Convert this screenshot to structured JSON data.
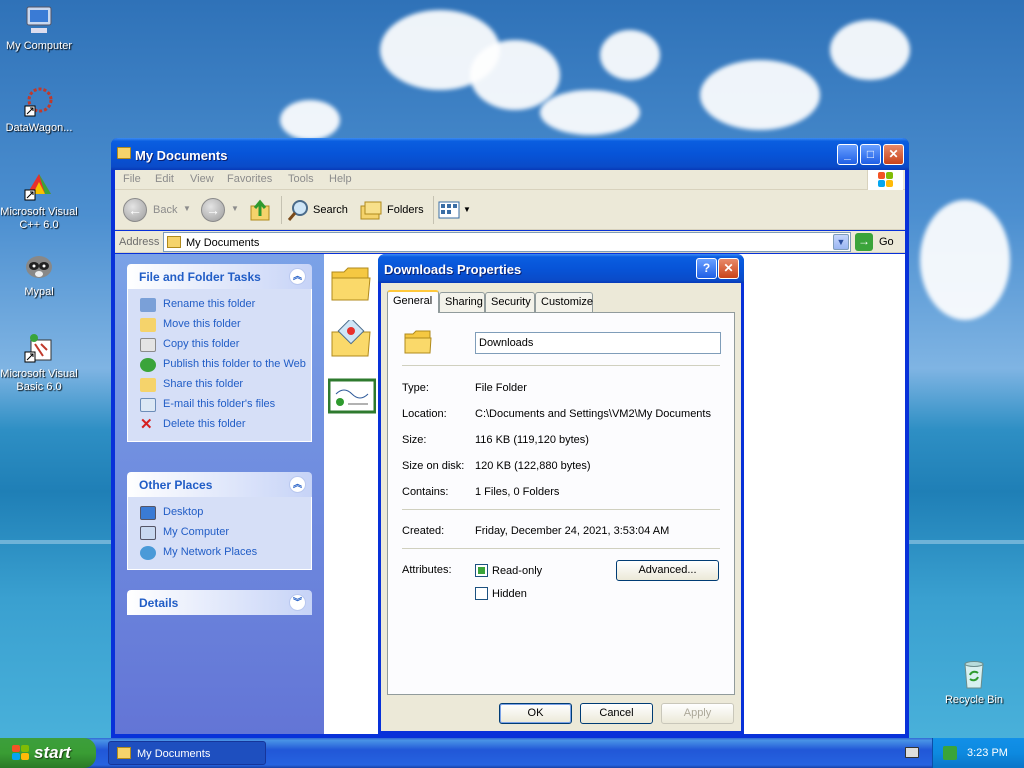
{
  "desktop": {
    "icons": [
      {
        "label": "My Computer"
      },
      {
        "label": "DataWagon..."
      },
      {
        "label": "Microsoft Visual C++ 6.0"
      },
      {
        "label": "Mypal"
      },
      {
        "label": "Microsoft Visual Basic 6.0"
      },
      {
        "label": "Recycle Bin"
      }
    ]
  },
  "explorer": {
    "title": "My Documents",
    "menu": [
      "File",
      "Edit",
      "View",
      "Favorites",
      "Tools",
      "Help"
    ],
    "toolbar": {
      "back": "Back",
      "search": "Search",
      "folders": "Folders"
    },
    "address": {
      "label": "Address",
      "value": "My Documents",
      "go": "Go"
    },
    "tasks_panel": {
      "title": "File and Folder Tasks",
      "items": [
        "Rename this folder",
        "Move this folder",
        "Copy this folder",
        "Publish this folder to the Web",
        "Share this folder",
        "E-mail this folder's files",
        "Delete this folder"
      ]
    },
    "places_panel": {
      "title": "Other Places",
      "items": [
        "Desktop",
        "My Computer",
        "My Network Places"
      ]
    },
    "details_panel": {
      "title": "Details"
    }
  },
  "dialog": {
    "title": "Downloads Properties",
    "tabs": [
      "General",
      "Sharing",
      "Security",
      "Customize"
    ],
    "active_tab": "General",
    "name_value": "Downloads",
    "fields": {
      "type": {
        "label": "Type:",
        "value": "File Folder"
      },
      "location": {
        "label": "Location:",
        "value": "C:\\Documents and Settings\\VM2\\My Documents"
      },
      "size": {
        "label": "Size:",
        "value": "116 KB (119,120 bytes)"
      },
      "size_on_disk": {
        "label": "Size on disk:",
        "value": "120 KB (122,880 bytes)"
      },
      "contains": {
        "label": "Contains:",
        "value": "1 Files, 0 Folders"
      },
      "created": {
        "label": "Created:",
        "value": "Friday, December 24, 2021, 3:53:04 AM"
      }
    },
    "attributes": {
      "label": "Attributes:",
      "readonly": "Read-only",
      "hidden": "Hidden",
      "advanced": "Advanced..."
    },
    "buttons": {
      "ok": "OK",
      "cancel": "Cancel",
      "apply": "Apply"
    }
  },
  "taskbar": {
    "start": "start",
    "task": "My Documents",
    "clock": "3:23 PM"
  },
  "colors": {
    "titlebar": "#0a5ee0",
    "task_link": "#215dc6",
    "start_green": "#3a9d34"
  }
}
